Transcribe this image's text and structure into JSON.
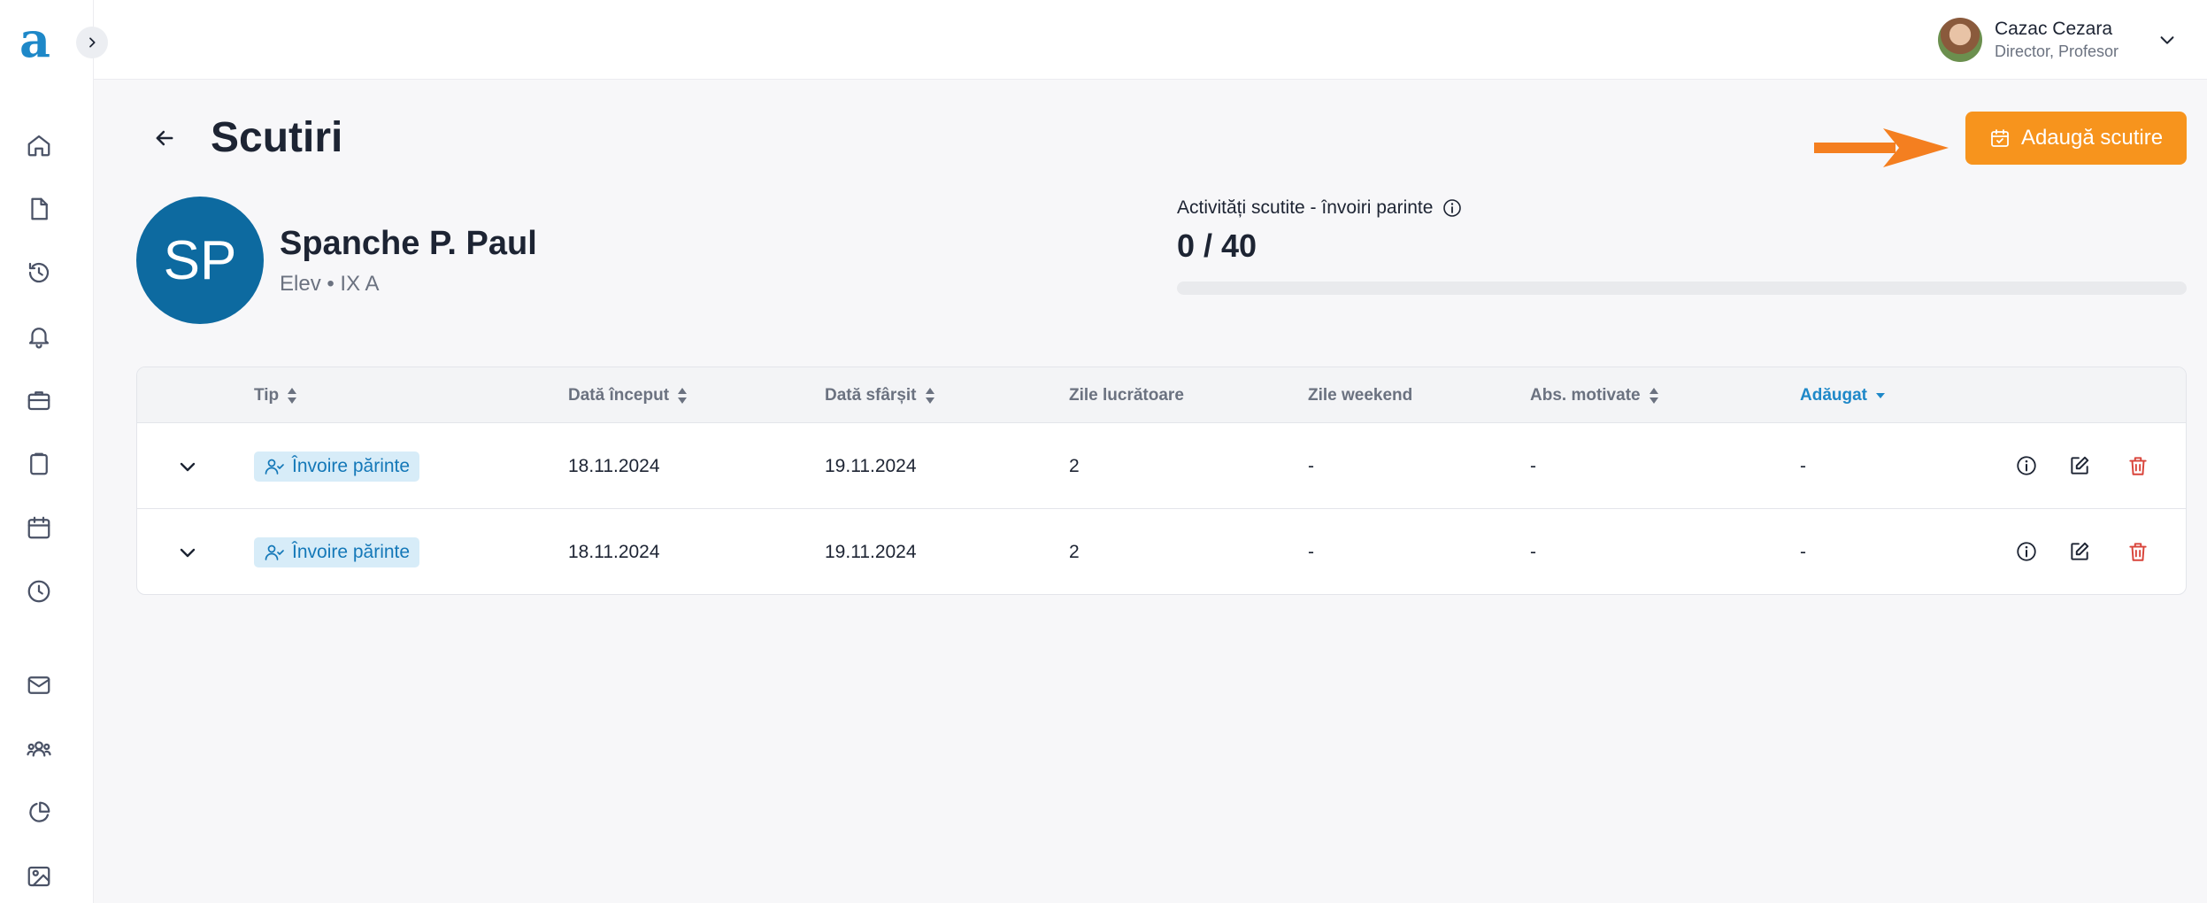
{
  "app": {
    "logo_letter": "a",
    "brand_color": "#1e88c8",
    "accent_color": "#f7941d"
  },
  "user": {
    "name": "Cazac Cezara",
    "role": "Director, Profesor"
  },
  "sidebar": {
    "icons": [
      "home-icon",
      "document-icon",
      "history-icon",
      "bell-icon",
      "briefcase-icon",
      "clipboard-icon",
      "calendar-icon",
      "clock-icon",
      "mail-icon",
      "users-icon",
      "pie-chart-icon",
      "image-icon"
    ]
  },
  "page": {
    "title": "Scutiri",
    "add_button_label": "Adaugă scutire"
  },
  "student": {
    "initials": "SP",
    "name": "Spanche P. Paul",
    "meta": "Elev • IX A"
  },
  "stats": {
    "label": "Activități scutite - învoiri parinte",
    "value": "0 / 40",
    "progress_fraction": 0
  },
  "table": {
    "headers": {
      "type": "Tip",
      "start": "Dată început",
      "end": "Dată sfârșit",
      "workdays": "Zile lucrătoare",
      "weekend": "Zile weekend",
      "abs": "Abs. motivate",
      "added": "Adăugat"
    },
    "rows": [
      {
        "type": "Învoire părinte",
        "start": "18.11.2024",
        "end": "19.11.2024",
        "workdays": "2",
        "weekend": "-",
        "abs": "-",
        "added": "-"
      },
      {
        "type": "Învoire părinte",
        "start": "18.11.2024",
        "end": "19.11.2024",
        "workdays": "2",
        "weekend": "-",
        "abs": "-",
        "added": "-"
      }
    ]
  }
}
